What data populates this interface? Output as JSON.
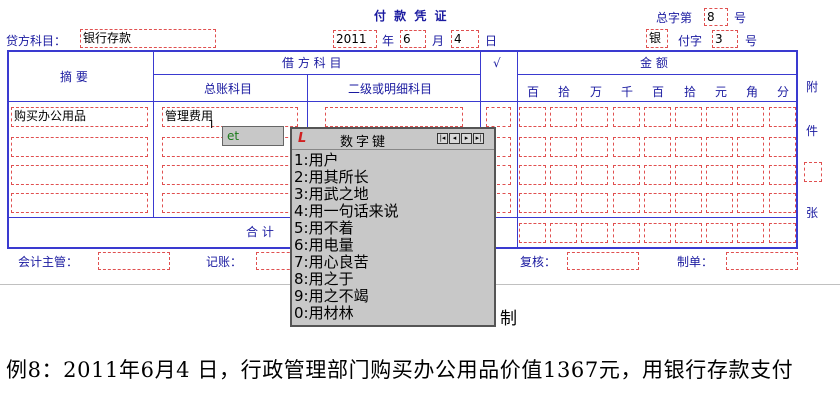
{
  "voucher": {
    "title": "付 款 凭 证",
    "total_no_label": "总字第",
    "total_no": "8",
    "hao": "号",
    "credit_account_label": "贷方科目：",
    "credit_account": "银行存款",
    "year": "2011",
    "year_label": "年",
    "month": "6",
    "month_label": "月",
    "day": "4",
    "day_label": "日",
    "word_prefix": "银",
    "word_label": "付字",
    "word_no": "3",
    "hao2": "号"
  },
  "table": {
    "summary_header": "摘  要",
    "debit_header": "借 方 科 目",
    "general_header": "总账科目",
    "detail_header": "二级或明细科目",
    "check_header": "√",
    "amount_header": "金  额",
    "digits": [
      "百",
      "拾",
      "万",
      "千",
      "百",
      "拾",
      "元",
      "角",
      "分"
    ],
    "rows": [
      {
        "summary": "购买办公用品",
        "general": "管理费用"
      },
      {
        "summary": "",
        "general": ""
      },
      {
        "summary": "",
        "general": ""
      },
      {
        "summary": "",
        "general": ""
      }
    ],
    "total_label": "合  计",
    "attach": [
      "附",
      "件",
      "张"
    ]
  },
  "footer": {
    "supervisor": "会计主管：",
    "bookkeeping": "记账：",
    "review": "复核：",
    "maker": "制单："
  },
  "ime": {
    "input_text": "et",
    "title": "数字键",
    "candidates": [
      "1:用户",
      "2:用其所长",
      "3:用武之地",
      "4:用一句话来说",
      "5:用不着",
      "6:用电量",
      "7:用心良苦",
      "8:用之于",
      "9:用之不竭",
      "0:用材林"
    ]
  },
  "caption": {
    "fragment": "制",
    "text": "例8：2011年6月4 日，行政管理部门购买办公用品价值1367元，用银行存款支付"
  }
}
